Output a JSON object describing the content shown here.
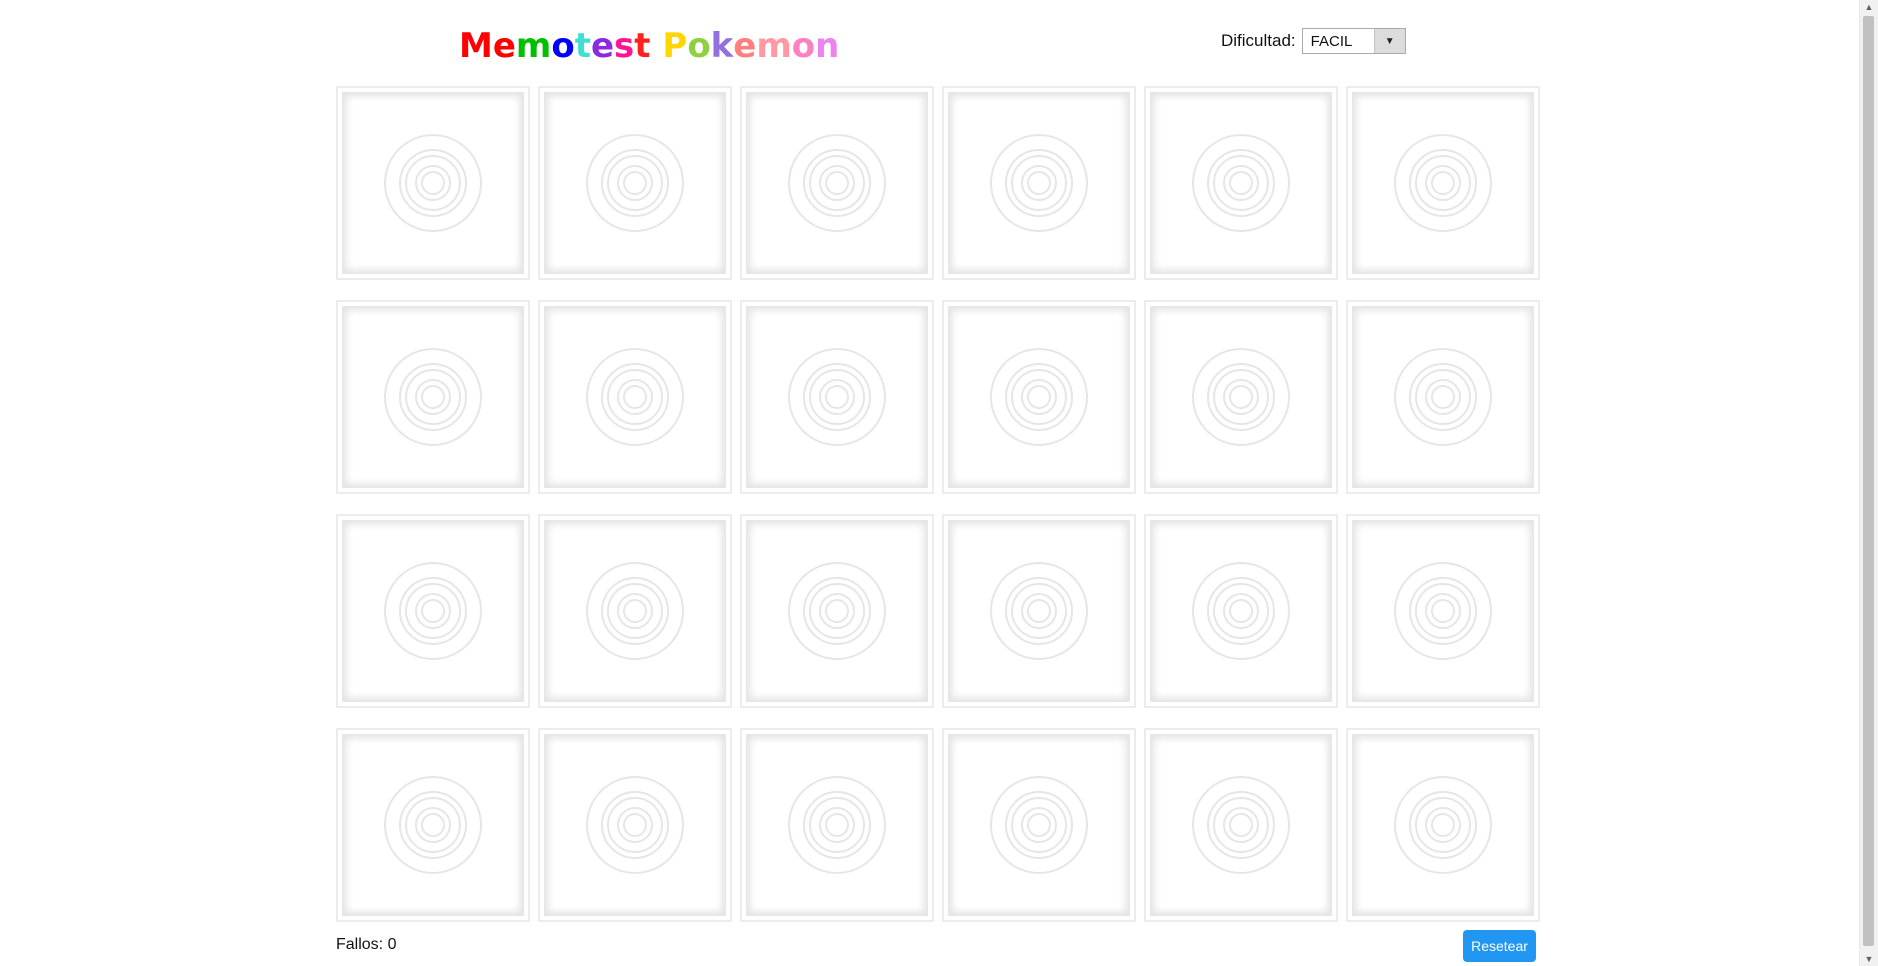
{
  "header": {
    "title_letters": [
      {
        "ch": "M",
        "color": "#ff0000"
      },
      {
        "ch": "e",
        "color": "#ff0000"
      },
      {
        "ch": "m",
        "color": "#00c000"
      },
      {
        "ch": "o",
        "color": "#0000ff"
      },
      {
        "ch": "t",
        "color": "#40e0d0"
      },
      {
        "ch": "e",
        "color": "#8a2be2"
      },
      {
        "ch": "s",
        "color": "#ff1493"
      },
      {
        "ch": "t",
        "color": "#ff2020"
      },
      {
        "ch": " ",
        "color": "#ffffff"
      },
      {
        "ch": "P",
        "color": "#ffd700"
      },
      {
        "ch": "o",
        "color": "#90d040"
      },
      {
        "ch": "k",
        "color": "#9370db"
      },
      {
        "ch": "e",
        "color": "#ff7f7f"
      },
      {
        "ch": "m",
        "color": "#ff9aa2"
      },
      {
        "ch": "o",
        "color": "#ff80c0"
      },
      {
        "ch": "n",
        "color": "#ee82ee"
      }
    ]
  },
  "difficulty": {
    "label": "Dificultad:",
    "selected": "FACIL",
    "arrow_icon": "▼"
  },
  "board": {
    "rows": 4,
    "columns": 6,
    "card_back_icon": "pokeball-back-icon",
    "card_colors": {
      "border": "#ececec",
      "ring": "#e6e6e6"
    }
  },
  "footer": {
    "fails_text": "Fallos: 0",
    "reset_label": "Resetear",
    "reset_color": "#2196f3"
  },
  "scrollbar": {
    "up_icon": "▲",
    "down_icon": "▼"
  }
}
